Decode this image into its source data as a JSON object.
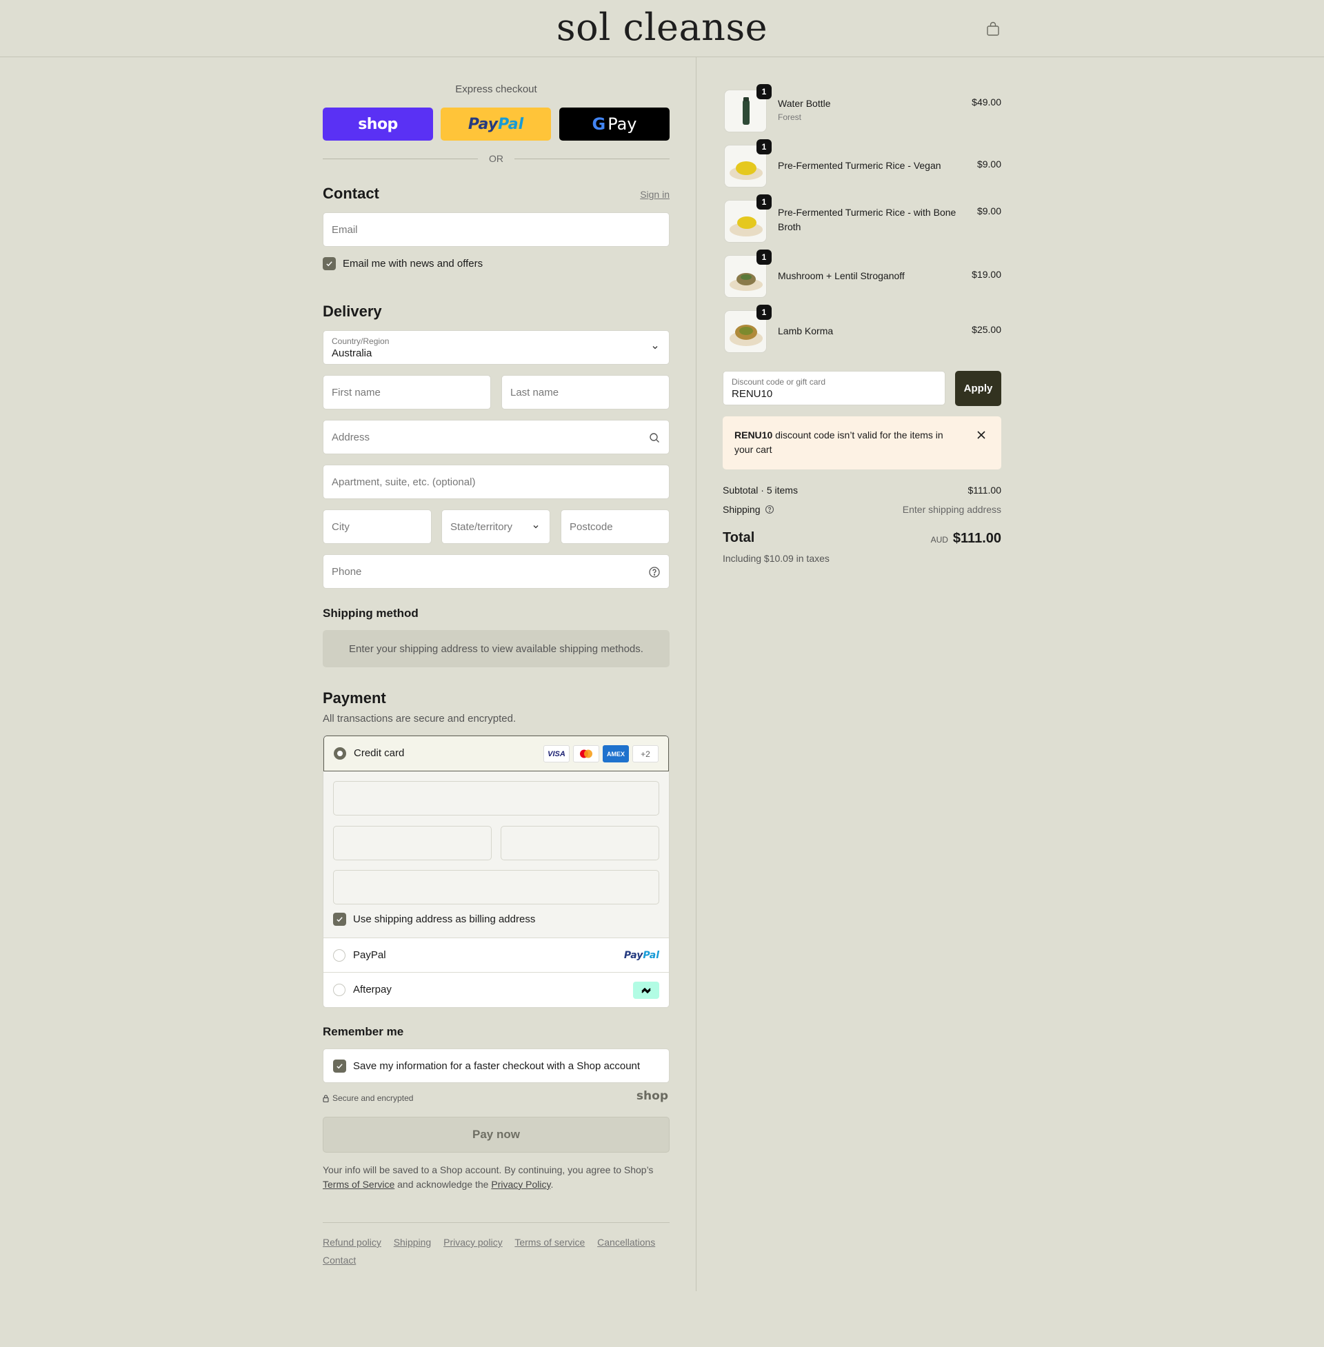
{
  "brand": "sol cleanse",
  "express": {
    "label": "Express checkout",
    "shop": "shop",
    "paypal_a": "Pay",
    "paypal_b": "Pal",
    "gpay_g": "G",
    "gpay": "Pay",
    "or": "OR"
  },
  "contact": {
    "heading": "Contact",
    "signin": "Sign in",
    "email_placeholder": "Email",
    "news_label": "Email me with news and offers"
  },
  "delivery": {
    "heading": "Delivery",
    "country_label": "Country/Region",
    "country_value": "Australia",
    "first_name": "First name",
    "last_name": "Last name",
    "address": "Address",
    "apartment": "Apartment, suite, etc. (optional)",
    "city": "City",
    "state": "State/territory",
    "postcode": "Postcode",
    "phone": "Phone"
  },
  "shipping_method": {
    "heading": "Shipping method",
    "placeholder": "Enter your shipping address to view available shipping methods."
  },
  "payment": {
    "heading": "Payment",
    "subheading": "All transactions are secure and encrypted.",
    "credit_card": "Credit card",
    "cards": [
      "VISA",
      "AMEX",
      "+2"
    ],
    "billing_label": "Use shipping address as billing address",
    "paypal": "PayPal",
    "paypal_logo_a": "Pay",
    "paypal_logo_b": "Pal",
    "afterpay": "Afterpay"
  },
  "remember": {
    "heading": "Remember me",
    "save_label": "Save my information for a faster checkout with a Shop account",
    "secure": "Secure and encrypted",
    "shop_mark": "shop"
  },
  "pay_now": "Pay now",
  "legal": {
    "text_a": "Your info will be saved to a Shop account. By continuing, you agree to Shop’s ",
    "terms": "Terms of Service",
    "text_b": " and acknowledge the ",
    "privacy": "Privacy Policy",
    "text_c": "."
  },
  "footer": [
    "Refund policy",
    "Shipping",
    "Privacy policy",
    "Terms of service",
    "Cancellations",
    "Contact"
  ],
  "cart": {
    "items": [
      {
        "name": "Water Bottle",
        "variant": "Forest",
        "price": "$49.00",
        "qty": "1"
      },
      {
        "name": "Pre-Fermented Turmeric Rice - Vegan",
        "price": "$9.00",
        "qty": "1"
      },
      {
        "name": "Pre-Fermented Turmeric Rice - with Bone Broth",
        "price": "$9.00",
        "qty": "1"
      },
      {
        "name": "Mushroom + Lentil Stroganoff",
        "price": "$19.00",
        "qty": "1"
      },
      {
        "name": "Lamb Korma",
        "price": "$25.00",
        "qty": "1"
      }
    ],
    "discount_label": "Discount code or gift card",
    "discount_value": "RENU10",
    "apply": "Apply",
    "error_code": "RENU10",
    "error_msg": " discount code isn’t valid for the items in your cart",
    "subtotal_label": "Subtotal · 5 items",
    "subtotal": "$111.00",
    "shipping_label": "Shipping",
    "shipping_value": "Enter shipping address",
    "total_label": "Total",
    "currency": "AUD",
    "total": "$111.00",
    "tax_note": "Including $10.09 in taxes"
  },
  "colors": {
    "background": "#deded2",
    "shop_pay": "#5a31f4",
    "paypal": "#ffc439",
    "apply_button": "#323220",
    "error_bg": "#fdf2e4"
  }
}
